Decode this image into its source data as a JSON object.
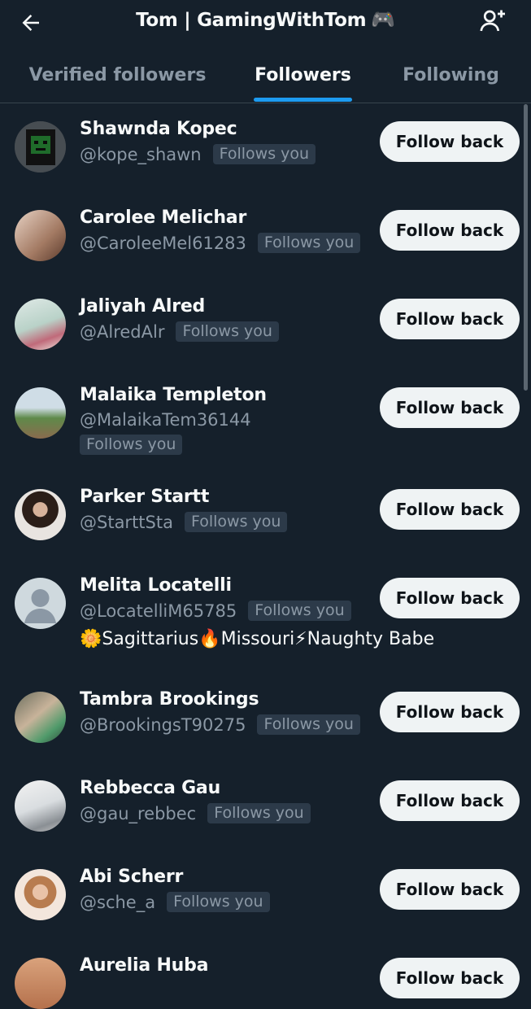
{
  "header": {
    "title": "Tom | GamingWithTom",
    "title_emoji": "🎮",
    "back_icon": "arrow-left-icon",
    "add_icon": "add-user-icon"
  },
  "tabs": [
    {
      "label": "Verified followers",
      "active": false
    },
    {
      "label": "Followers",
      "active": true
    },
    {
      "label": "Following",
      "active": false
    }
  ],
  "colors": {
    "background": "#15202b",
    "accent": "#1d9bf0",
    "button_bg": "#eff3f4",
    "muted_text": "#8b98a5",
    "badge_bg": "#2c3a49"
  },
  "followers": [
    {
      "name": "Shawnda Kopec",
      "handle": "@kope_shawn",
      "badge": "Follows you",
      "button": "Follow back"
    },
    {
      "name": "Carolee Melichar",
      "handle": "@CaroleeMel61283",
      "badge": "Follows you",
      "button": "Follow back"
    },
    {
      "name": "Jaliyah Alred",
      "handle": "@AlredAlr",
      "badge": "Follows you",
      "button": "Follow back"
    },
    {
      "name": "Malaika Templeton",
      "handle": "@MalaikaTem36144",
      "badge": "Follows you",
      "button": "Follow back"
    },
    {
      "name": "Parker Startt",
      "handle": "@StarttSta",
      "badge": "Follows you",
      "button": "Follow back"
    },
    {
      "name": "Melita Locatelli",
      "handle": "@LocatelliM65785",
      "badge": "Follows you",
      "button": "Follow back",
      "bio": "🌼Sagittarius🔥Missouri⚡Naughty Babe"
    },
    {
      "name": "Tambra Brookings",
      "handle": "@BrookingsT90275",
      "badge": "Follows you",
      "button": "Follow back"
    },
    {
      "name": "Rebbecca Gau",
      "handle": "@gau_rebbec",
      "badge": "Follows you",
      "button": "Follow back"
    },
    {
      "name": "Abi Scherr",
      "handle": "@sche_a",
      "badge": "Follows you",
      "button": "Follow back"
    },
    {
      "name": "Aurelia Huba",
      "button": "Follow back"
    }
  ]
}
